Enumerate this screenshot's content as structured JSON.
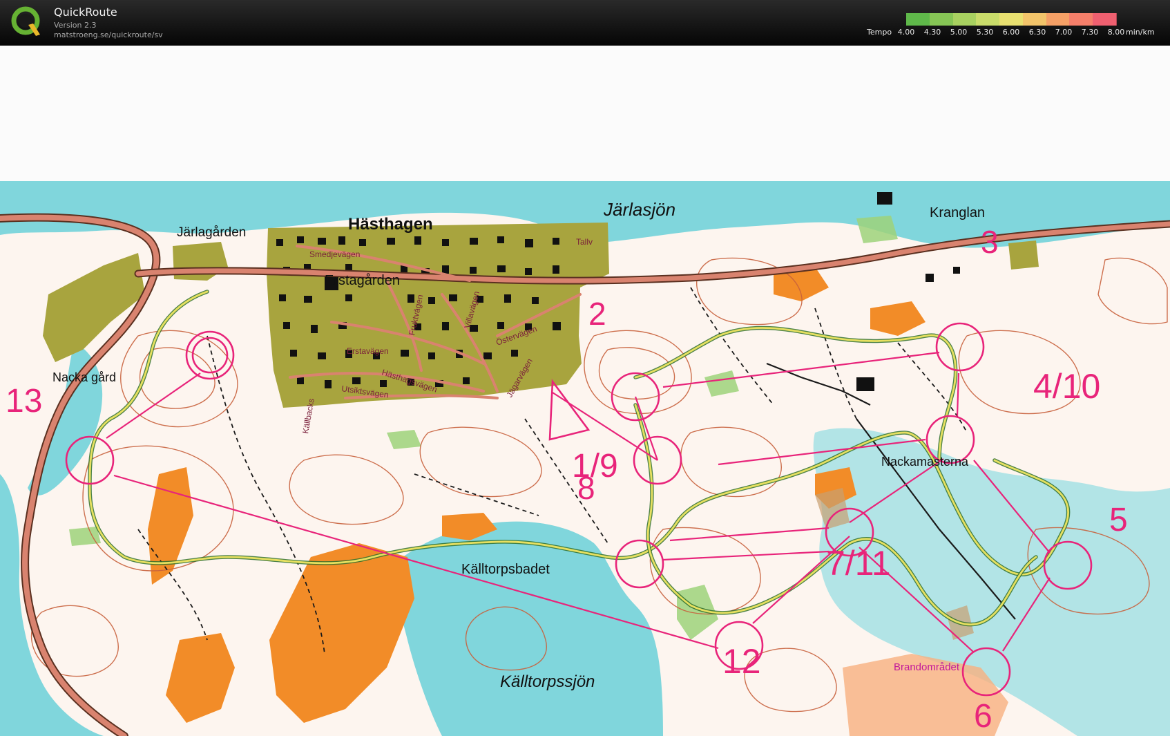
{
  "app": {
    "title": "QuickRoute",
    "version": "Version 2.3",
    "url": "matstroeng.se/quickroute/sv"
  },
  "legend": {
    "label": "Tempo",
    "unit": "min/km",
    "ticks": [
      "4.00",
      "4.30",
      "5.00",
      "5.30",
      "6.00",
      "6.30",
      "7.00",
      "7.30",
      "8.00"
    ],
    "colors": [
      "#5fb84a",
      "#86c555",
      "#a8d160",
      "#c9dc6a",
      "#e8e070",
      "#f2c46a",
      "#f5a066",
      "#f57f6a",
      "#ef6070"
    ]
  },
  "map": {
    "place_names": [
      "Järlasjön",
      "Hästhagen",
      "Järlagården",
      "Kranglan",
      "Erstagården",
      "Nacka gård",
      "Källtorpsbadet",
      "Källtorpssjön",
      "Nackamasterna",
      "Brandområdet"
    ],
    "street_names": [
      "Smedjevägen",
      "Fruktvägen",
      "Villavägen",
      "Östervägen",
      "Erstavägen",
      "Hästhagsvägen",
      "Utsiktsvägen",
      "Jägarvägen",
      "Tallv",
      "Källbacks"
    ],
    "controls": [
      "1/9",
      "2",
      "3",
      "4/10",
      "5",
      "6",
      "7/11",
      "8",
      "12",
      "13"
    ]
  },
  "colors": {
    "water": "#7fd6dc",
    "contour": "#c8613c",
    "course": "#e8247a",
    "urban": "#a6a23c",
    "open": "#f28c28",
    "forest": "#fdf6f0",
    "road": "#d9836f"
  }
}
